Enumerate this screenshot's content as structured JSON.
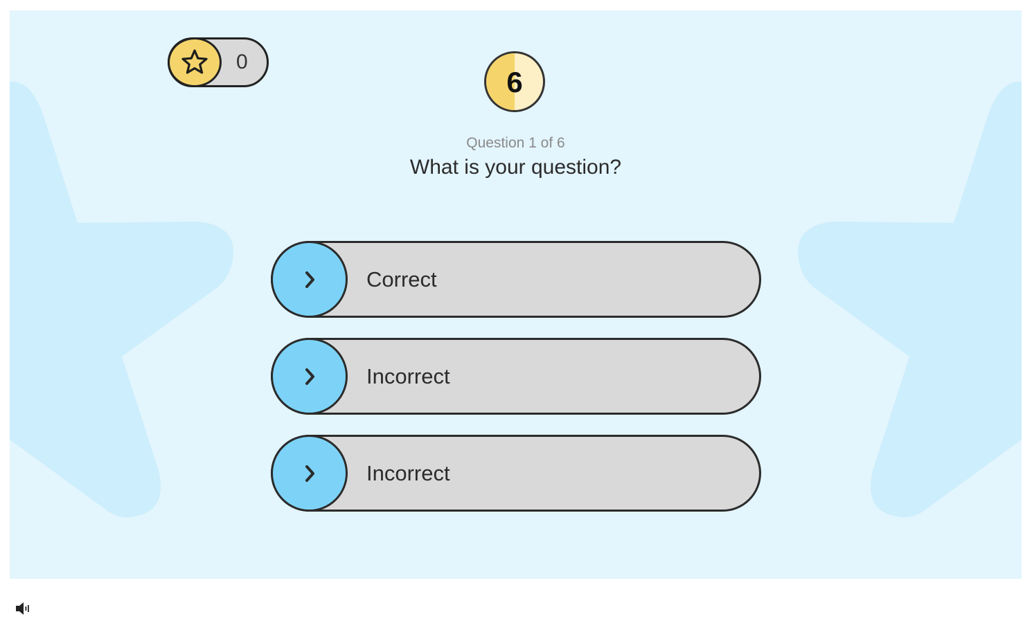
{
  "score": {
    "icon": "star-icon",
    "value": "0"
  },
  "timer": {
    "value": "6",
    "remaining_fraction": 0.5
  },
  "question": {
    "counter": "Question 1 of 6",
    "text": "What is your question?"
  },
  "answers": [
    {
      "label": "Correct",
      "icon": "chevron-right-icon"
    },
    {
      "label": "Incorrect",
      "icon": "chevron-right-icon"
    },
    {
      "label": "Incorrect",
      "icon": "chevron-right-icon"
    }
  ],
  "controls": {
    "sound_icon": "volume-icon"
  },
  "colors": {
    "background": "#e3f5fd",
    "background_star": "#cdeefc",
    "accent_yellow": "#f5d56b",
    "accent_blue": "#7dd3f7",
    "pill_gray": "#d9d9d9",
    "outline": "#2b2b2b"
  }
}
